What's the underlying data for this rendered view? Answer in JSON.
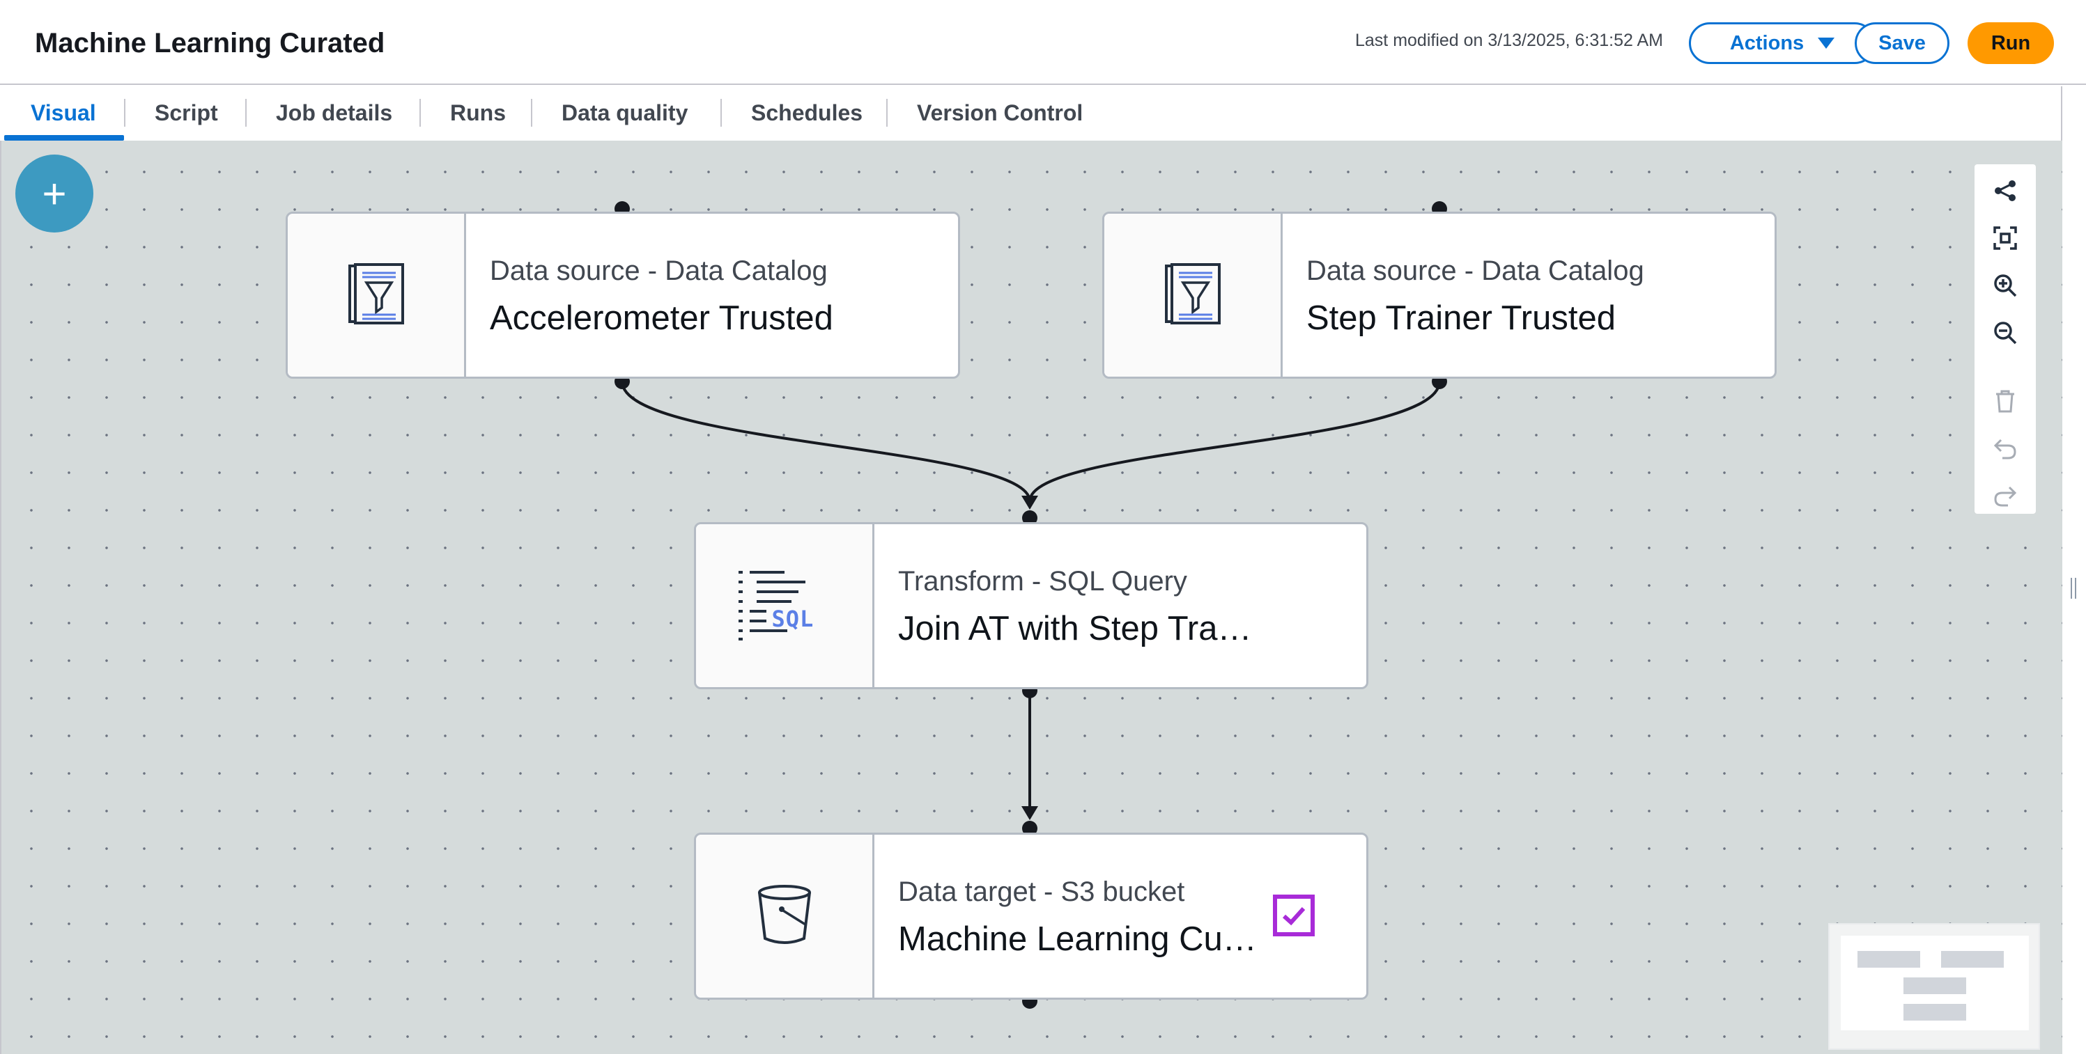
{
  "header": {
    "title": "Machine Learning Curated",
    "last_modified": "Last modified on 3/13/2025, 6:31:52 AM",
    "actions_label": "Actions",
    "save_label": "Save",
    "run_label": "Run"
  },
  "tabs": [
    {
      "label": "Visual",
      "active": true
    },
    {
      "label": "Script"
    },
    {
      "label": "Job details"
    },
    {
      "label": "Runs"
    },
    {
      "label": "Data quality"
    },
    {
      "label": "Schedules"
    },
    {
      "label": "Version Control"
    }
  ],
  "canvas": {
    "add_button": "+",
    "nodes": [
      {
        "type": "Data source - Data Catalog",
        "name": "Accelerometer Trusted",
        "icon": "data-catalog-icon"
      },
      {
        "type": "Data source - Data Catalog",
        "name": "Step Trainer Trusted",
        "icon": "data-catalog-icon"
      },
      {
        "type": "Transform - SQL Query",
        "name": "Join AT with Step Tra…",
        "icon": "sql-query-icon",
        "icon_text": "SQL"
      },
      {
        "type": "Data target - S3 bucket",
        "name": "Machine Learning Cu…",
        "icon": "s3-bucket-icon",
        "selected": true
      }
    ]
  },
  "toolbar": [
    "layout-icon",
    "fit-view-icon",
    "zoom-in-icon",
    "zoom-out-icon",
    "delete-icon",
    "undo-icon",
    "redo-icon"
  ],
  "colors": {
    "accent": "#0972d3",
    "run_button": "#ff9900",
    "add_button": "#3d9ac1",
    "selected_badge": "#a82bd8",
    "sql_text": "#5b7fe6"
  }
}
